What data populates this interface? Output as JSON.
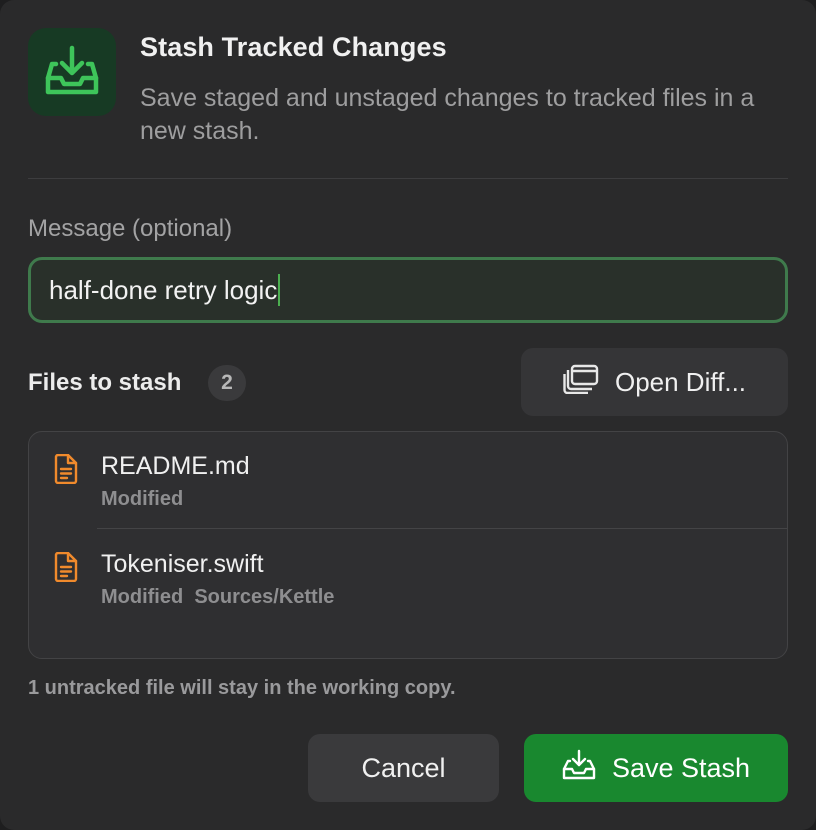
{
  "header": {
    "title": "Stash Tracked Changes",
    "subtitle": "Save staged and unstaged changes to tracked files in a new stash.",
    "icon": "tray-download-icon",
    "accent_color": "#3ec45a"
  },
  "message": {
    "label": "Message (optional)",
    "value": "half-done retry logic"
  },
  "files": {
    "label": "Files to stash",
    "count": "2",
    "open_diff_label": "Open Diff...",
    "items": [
      {
        "name": "README.md",
        "status": "Modified",
        "path": ""
      },
      {
        "name": "Tokeniser.swift",
        "status": "Modified",
        "path": "Sources/Kettle"
      }
    ],
    "file_icon_color": "#f08a2c"
  },
  "footnote": "1 untracked file will stay in the working copy.",
  "actions": {
    "cancel_label": "Cancel",
    "save_label": "Save Stash",
    "save_color": "#19882f"
  }
}
